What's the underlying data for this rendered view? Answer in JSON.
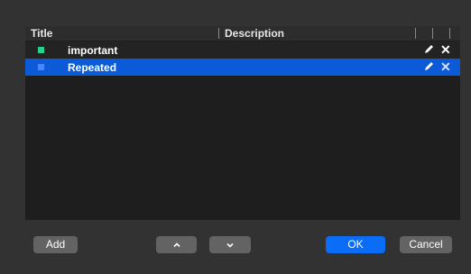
{
  "table": {
    "columns": {
      "title": "Title",
      "description": "Description"
    },
    "rows": [
      {
        "label": "important",
        "color": "#2ad08b",
        "selected": false
      },
      {
        "label": "Repeated",
        "color": "#4a86ff",
        "selected": true
      }
    ]
  },
  "buttons": {
    "add": "Add",
    "ok": "OK",
    "cancel": "Cancel"
  },
  "icons": {
    "edit": "pencil-icon",
    "delete": "close-icon",
    "move_up": "chevron-up-icon",
    "move_down": "chevron-down-icon"
  },
  "colors": {
    "selection": "#0b5bd8",
    "accent": "#0b6cf5"
  }
}
